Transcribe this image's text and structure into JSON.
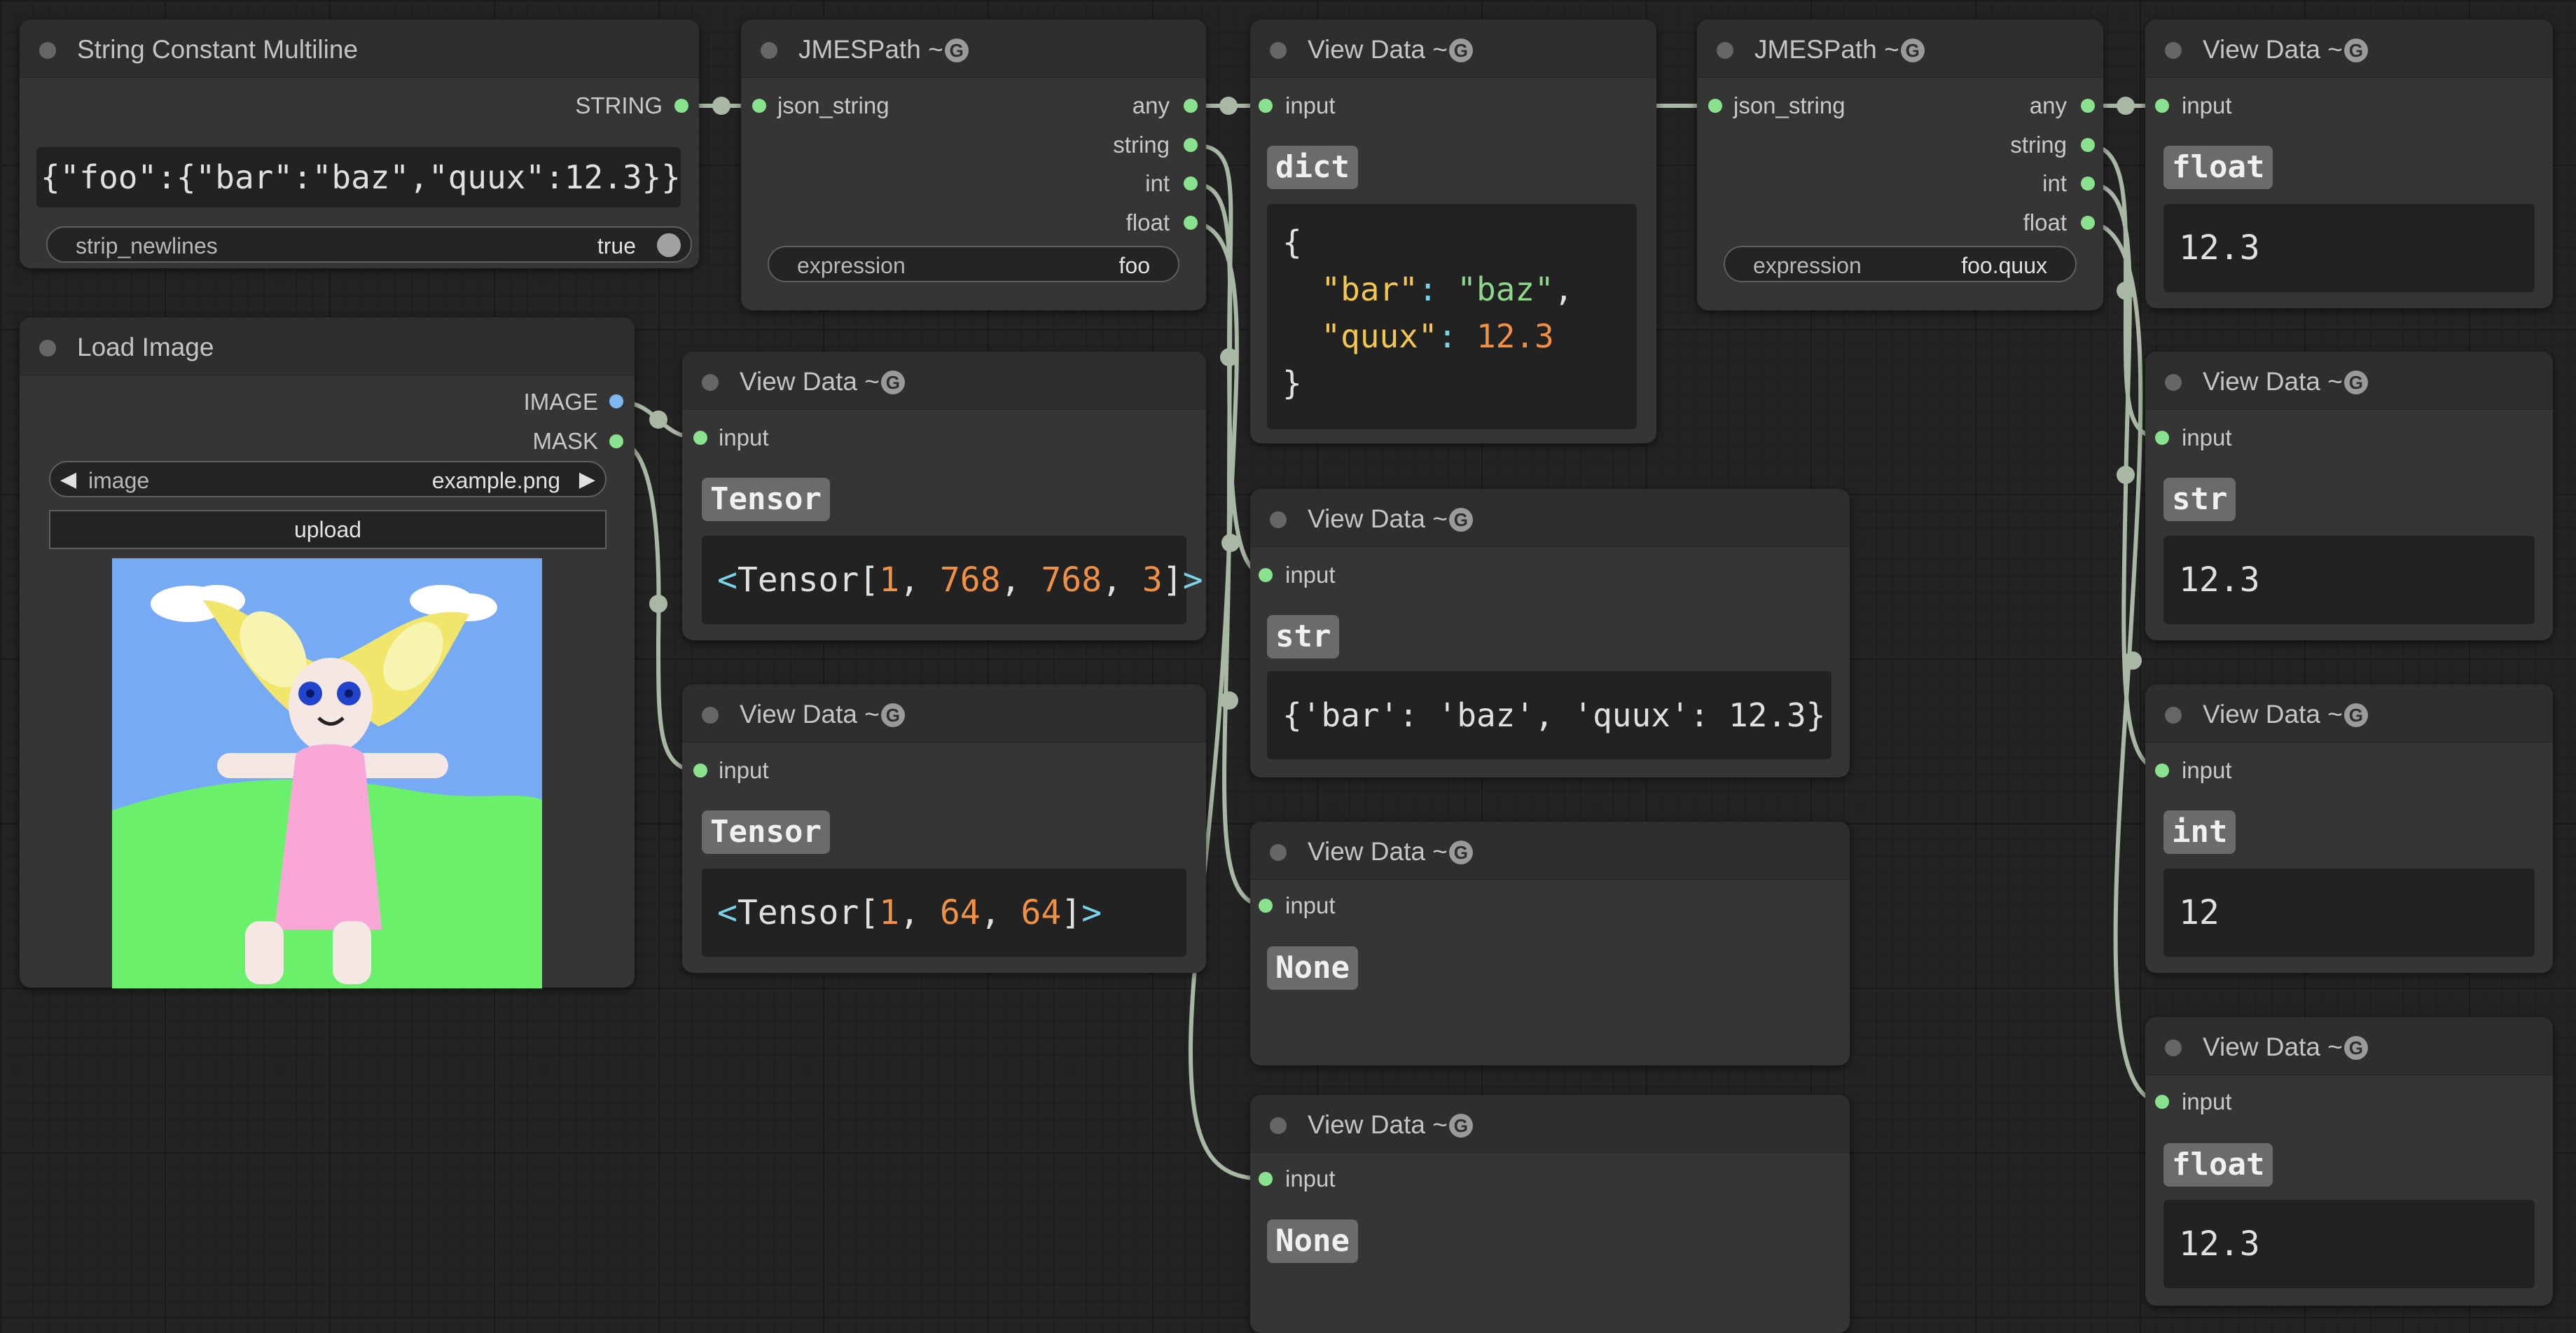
{
  "colors": {
    "canvas": "#232323",
    "node_body": "#353535",
    "node_header": "#2e2e2e",
    "wire": "#a9b8a5",
    "pin_green": "#8be28e",
    "pin_blue": "#7fb7ef",
    "json_key": "#f3c74d",
    "json_string": "#8fd78a",
    "number": "#f09045",
    "punctuation": "#7ad3e6"
  },
  "icons": {
    "node_badge": "g-circle-icon"
  },
  "nodes": {
    "string_const": {
      "title": "String Constant Multiline",
      "output": "STRING",
      "text": "{\"foo\":{\"bar\":\"baz\",\"quux\":12.3}}",
      "toggle_label": "strip_newlines",
      "toggle_value": "true"
    },
    "load_image": {
      "title": "Load Image",
      "out_image": "IMAGE",
      "out_mask": "MASK",
      "combo_label": "image",
      "combo_value": "example.png",
      "upload_label": "upload"
    },
    "jmes1": {
      "title": "JMESPath ~",
      "input": "json_string",
      "outputs": [
        "any",
        "string",
        "int",
        "float"
      ],
      "expr_label": "expression",
      "expr_value": "foo"
    },
    "jmes2": {
      "title": "JMESPath ~",
      "input": "json_string",
      "outputs": [
        "any",
        "string",
        "int",
        "float"
      ],
      "expr_label": "expression",
      "expr_value": "foo.quux"
    },
    "view_dict": {
      "title": "View Data ~",
      "input": "input",
      "type": "dict",
      "lines": {
        "open": "{",
        "k1": "\"bar\"",
        "c1": ": ",
        "v1": "\"baz\"",
        "e1": ",",
        "k2": "\"quux\"",
        "c2": ": ",
        "v2": "12.3",
        "close": "}"
      }
    },
    "view_tensor1": {
      "title": "View Data ~",
      "input": "input",
      "type": "Tensor",
      "value": {
        "lt": "<",
        "name": "Tensor[",
        "n1": "1",
        "s1": ", ",
        "n2": "768",
        "s2": ", ",
        "n3": "768",
        "s3": ", ",
        "n4": "3",
        "rb": "]",
        "gt": ">"
      }
    },
    "view_tensor2": {
      "title": "View Data ~",
      "input": "input",
      "type": "Tensor",
      "value": {
        "lt": "<",
        "name": "Tensor[",
        "n1": "1",
        "s1": ", ",
        "n2": "64",
        "s2": ", ",
        "n3": "64",
        "rb": "]",
        "gt": ">"
      }
    },
    "view_str1": {
      "title": "View Data ~",
      "input": "input",
      "type": "str",
      "value": "{'bar': 'baz', 'quux': 12.3}"
    },
    "view_none1": {
      "title": "View Data ~",
      "input": "input",
      "type": "None"
    },
    "view_none2": {
      "title": "View Data ~",
      "input": "input",
      "type": "None"
    },
    "view_float1": {
      "title": "View Data ~",
      "input": "input",
      "type": "float",
      "value": "12.3"
    },
    "view_str2": {
      "title": "View Data ~",
      "input": "input",
      "type": "str",
      "value": "12.3"
    },
    "view_int": {
      "title": "View Data ~",
      "input": "input",
      "type": "int",
      "value": "12"
    },
    "view_float2": {
      "title": "View Data ~",
      "input": "input",
      "type": "float",
      "value": "12.3"
    }
  }
}
